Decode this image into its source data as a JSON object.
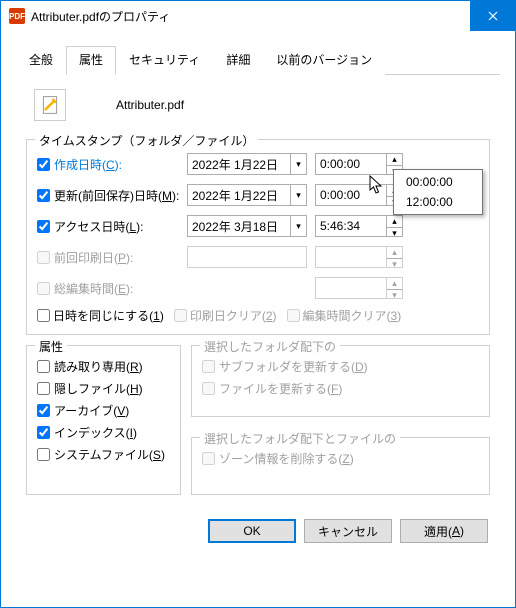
{
  "title": "Attributer.pdfのプロパティ",
  "filename": "Attributer.pdf",
  "tabs": {
    "general": "全般",
    "attributes": "属性",
    "security": "セキュリティ",
    "details": "詳細",
    "previous": "以前のバージョン"
  },
  "timestamp_group": {
    "legend": "タイムスタンプ（フォルダ／ファイル）",
    "created": {
      "label_pre": "作成日時(",
      "key": "C",
      "label_post": "):",
      "date": "2022年  1月22日",
      "time": "0:00:00",
      "checked": true
    },
    "modified": {
      "label_pre": "更新(前回保存)日時(",
      "key": "M",
      "label_post": "):",
      "date": "2022年  1月22日",
      "time": "0:00:00",
      "checked": true
    },
    "accessed": {
      "label_pre": "アクセス日時(",
      "key": "L",
      "label_post": "):",
      "date": "2022年  3月18日",
      "time": "5:46:34",
      "checked": true
    },
    "printed": {
      "label_pre": "前回印刷日(",
      "key": "P",
      "label_post": "):",
      "date": "",
      "time": "",
      "checked": false
    },
    "edit_time": {
      "label_pre": "総編集時間(",
      "key": "E",
      "label_post": "):",
      "date": "",
      "time": "",
      "checked": false
    },
    "sync": {
      "pre": "日時を同じにする(",
      "key": "1",
      "post": ")"
    },
    "clear_print": {
      "pre": "印刷日クリア(",
      "key": "2",
      "post": ")"
    },
    "clear_edit": {
      "pre": "編集時間クリア(",
      "key": "3",
      "post": ")"
    }
  },
  "attr_group": {
    "legend": "属性",
    "readonly": {
      "pre": "読み取り専用(",
      "key": "R",
      "post": ")",
      "checked": false
    },
    "hidden": {
      "pre": "隠しファイル(",
      "key": "H",
      "post": ")",
      "checked": false
    },
    "archive": {
      "pre": "アーカイブ(",
      "key": "V",
      "post": ")",
      "checked": true
    },
    "index": {
      "pre": "インデックス(",
      "key": "I",
      "post": ")",
      "checked": true
    },
    "system": {
      "pre": "システムファイル(",
      "key": "S",
      "post": ")",
      "checked": false
    }
  },
  "folder_group": {
    "legend": "選択したフォルダ配下の",
    "subfolder": {
      "pre": "サブフォルダを更新する(",
      "key": "D",
      "post": ")"
    },
    "files": {
      "pre": "ファイルを更新する(",
      "key": "F",
      "post": ")"
    }
  },
  "zone_group": {
    "legend": "選択したフォルダ配下とファイルの",
    "zone": {
      "pre": "ゾーン情報を削除する(",
      "key": "Z",
      "post": ")"
    }
  },
  "buttons": {
    "ok": "OK",
    "cancel": "キャンセル",
    "apply": {
      "pre": "適用(",
      "key": "A",
      "post": ")"
    }
  },
  "popup": {
    "item1": "00:00:00",
    "item2": "12:00:00"
  }
}
